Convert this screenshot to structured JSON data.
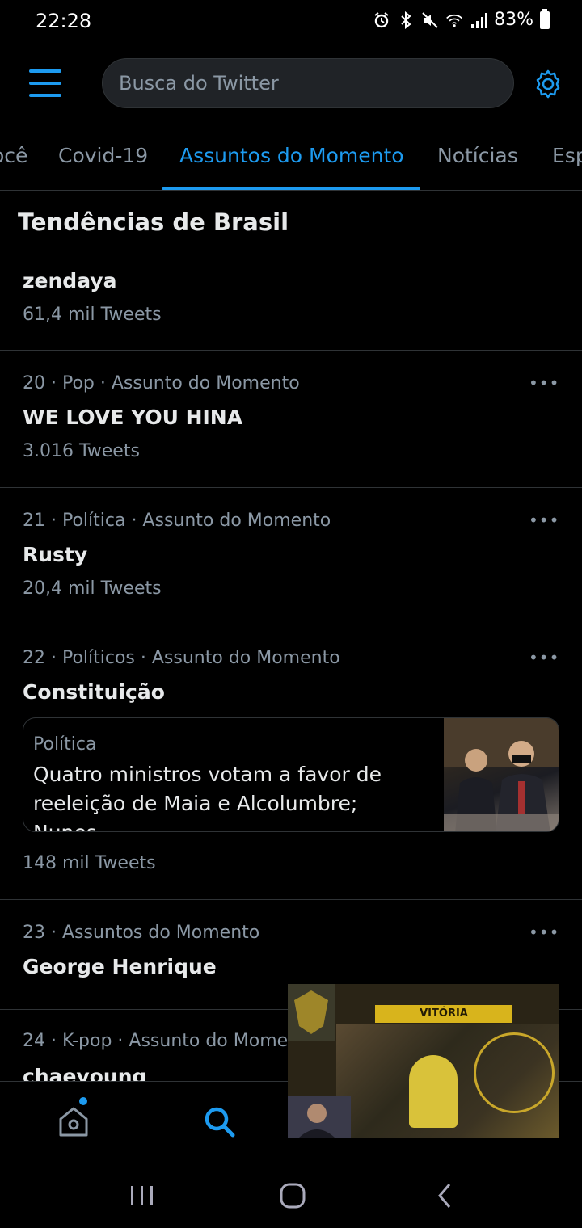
{
  "status_bar": {
    "time": "22:28",
    "battery": "83%",
    "icons": [
      "alarm-icon",
      "bluetooth-icon",
      "mute-icon",
      "wifi-icon",
      "signal-icon",
      "battery-icon"
    ]
  },
  "header": {
    "search_placeholder": "Busca do Twitter"
  },
  "tabs": [
    {
      "label": "ocê"
    },
    {
      "label": "Covid-19"
    },
    {
      "label": "Assuntos do Momento",
      "active": true
    },
    {
      "label": "Notícias"
    },
    {
      "label": "Esp"
    }
  ],
  "section": {
    "title": "Tendências de Brasil"
  },
  "trends": [
    {
      "meta": "",
      "name": "zendaya",
      "count": "61,4 mil Tweets"
    },
    {
      "meta": "20 · Pop · Assunto do Momento",
      "name": "WE LOVE YOU HINA",
      "count": "3.016 Tweets"
    },
    {
      "meta": "21 · Política · Assunto do Momento",
      "name": "Rusty",
      "count": "20,4 mil Tweets"
    },
    {
      "meta": "22 · Políticos · Assunto do Momento",
      "name": "Constituição",
      "card": {
        "category": "Política",
        "headline": "Quatro ministros votam a favor de reeleição de Maia e Alcolumbre; Nunes..."
      },
      "count": "148 mil Tweets"
    },
    {
      "meta": "23 · Assuntos do Momento",
      "name": "George Henrique",
      "count": ""
    },
    {
      "meta": "24 · K-pop · Assunto do Mome",
      "name": "chaeyoung",
      "count": ""
    }
  ],
  "more_label": "•••",
  "video": {
    "banner": "VITÓRIA"
  },
  "colors": {
    "accent": "#1d9bf0",
    "background": "#000000",
    "text_primary": "#e7e9ea",
    "text_secondary": "#8b98a5",
    "divider": "#2f3336"
  }
}
